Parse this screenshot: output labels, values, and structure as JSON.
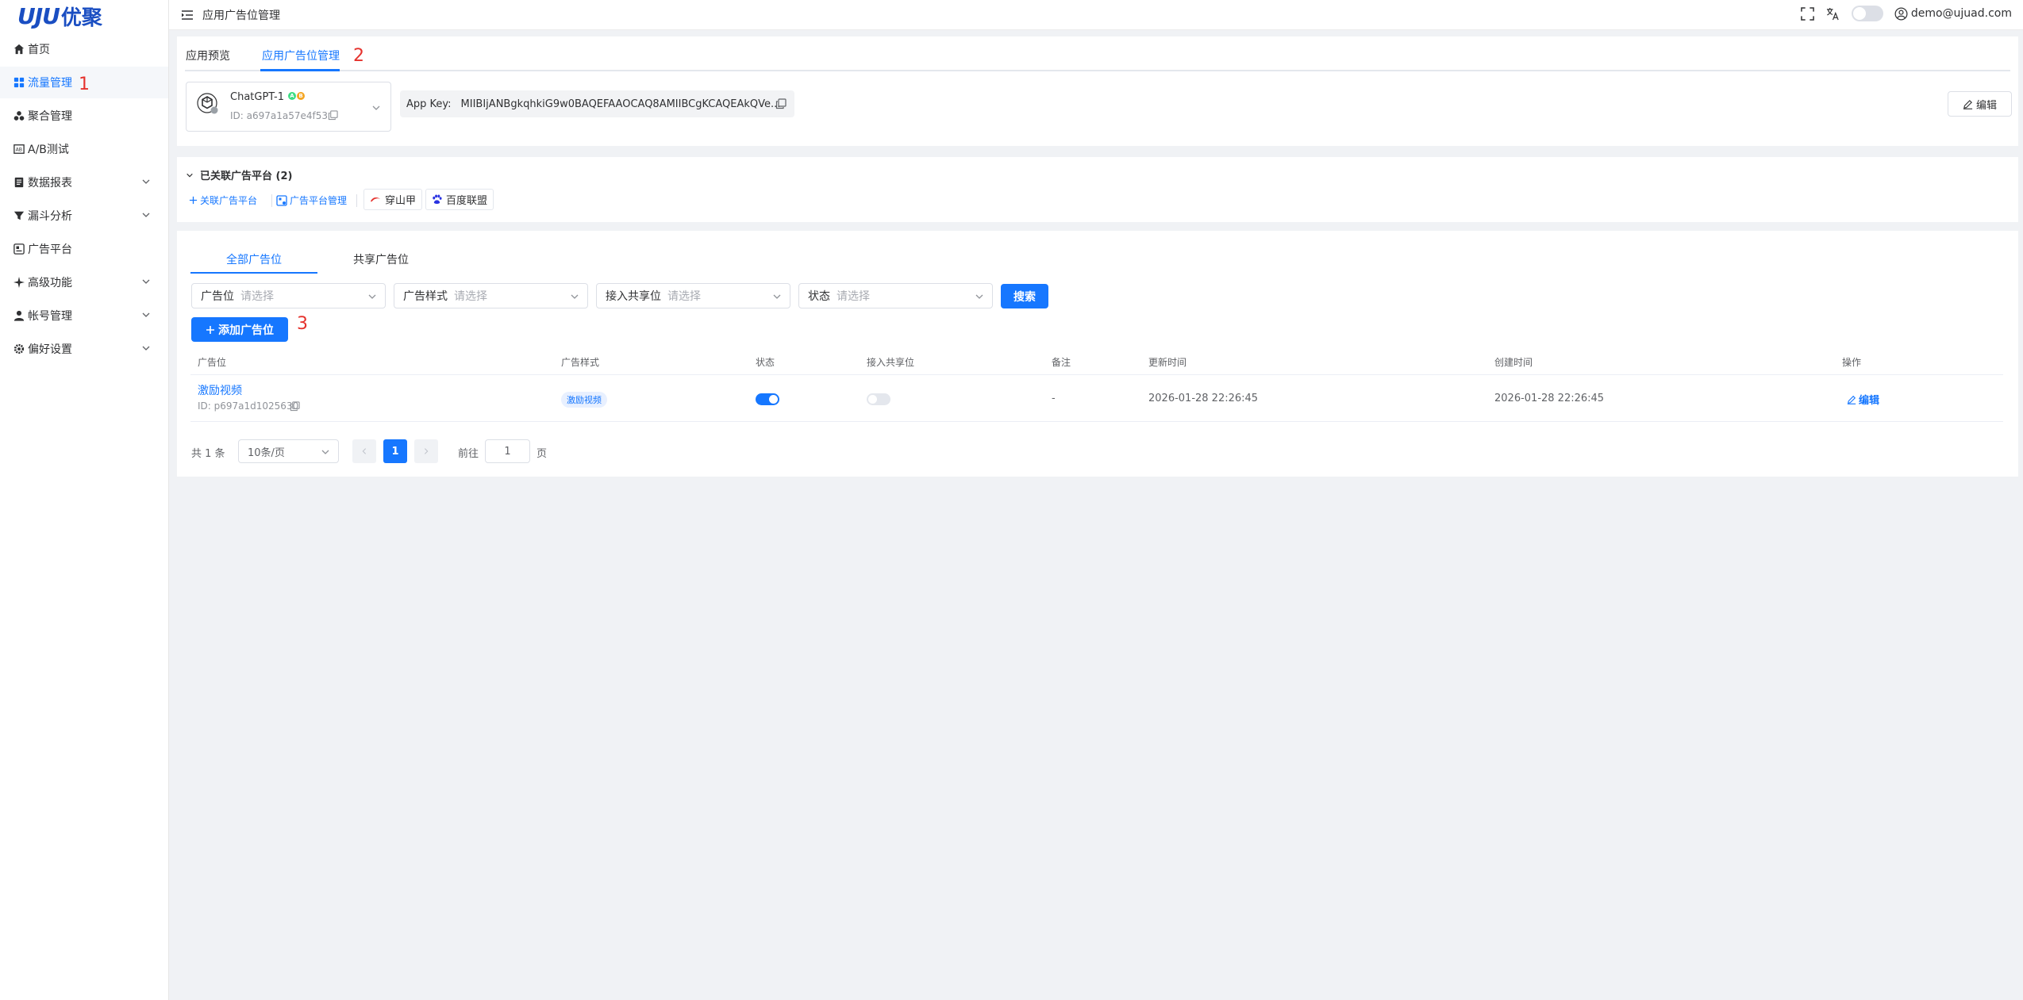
{
  "brand": {
    "logo_mark": "UJU",
    "logo_cn": "优聚"
  },
  "sidebar": {
    "items": [
      {
        "label": "首页",
        "icon": "home-icon"
      },
      {
        "label": "流量管理",
        "icon": "grid-icon",
        "active": true
      },
      {
        "label": "聚合管理",
        "icon": "cluster-icon"
      },
      {
        "label": "A/B测试",
        "icon": "ab-test-icon"
      },
      {
        "label": "数据报表",
        "icon": "report-icon",
        "expandable": true
      },
      {
        "label": "漏斗分析",
        "icon": "funnel-icon",
        "expandable": true
      },
      {
        "label": "广告平台",
        "icon": "ad-platform-icon"
      },
      {
        "label": "高级功能",
        "icon": "sparkle-icon",
        "expandable": true
      },
      {
        "label": "帐号管理",
        "icon": "user-icon",
        "expandable": true
      },
      {
        "label": "偏好设置",
        "icon": "gear-icon",
        "expandable": true
      }
    ]
  },
  "annotations": {
    "a1": "1",
    "a2": "2",
    "a3": "3"
  },
  "header": {
    "title": "应用广告位管理",
    "user_email": "demo@ujuad.com"
  },
  "top_tabs": [
    {
      "label": "应用预览"
    },
    {
      "label": "应用广告位管理",
      "active": true
    }
  ],
  "app": {
    "name": "ChatGPT-1",
    "id_text": "ID: a697a1a57e4f53",
    "app_key_label": "App Key:",
    "app_key_value": "MIIBIjANBgkqhkiG9w0BAQEFAAOCAQ8AMIIBCgKCAQEAkQVe...",
    "edit_label": "编辑"
  },
  "platforms": {
    "section_title": "已关联广告平台 (2)",
    "link_label": "关联广告平台",
    "manage_label": "广告平台管理",
    "tags": [
      "穿山甲",
      "百度联盟"
    ]
  },
  "list": {
    "tabs": [
      {
        "label": "全部广告位",
        "active": true
      },
      {
        "label": "共享广告位"
      }
    ],
    "filters": [
      {
        "label": "广告位",
        "placeholder": "请选择"
      },
      {
        "label": "广告样式",
        "placeholder": "请选择"
      },
      {
        "label": "接入共享位",
        "placeholder": "请选择"
      },
      {
        "label": "状态",
        "placeholder": "请选择"
      }
    ],
    "search_label": "搜索",
    "add_label": "添加广告位",
    "columns": [
      "广告位",
      "广告样式",
      "状态",
      "接入共享位",
      "备注",
      "更新时间",
      "创建时间",
      "操作"
    ],
    "rows": [
      {
        "name": "激励视频",
        "id_text": "ID: p697a1d1025630",
        "style": "激励视频",
        "status": true,
        "shared": false,
        "remark": "-",
        "updated": "2026-01-28 22:26:45",
        "created": "2026-01-28 22:26:45",
        "action": "编辑"
      }
    ]
  },
  "pagination": {
    "total_text": "共 1 条",
    "page_size": "10条/页",
    "current_page": "1",
    "goto_label": "前往",
    "goto_value": "1",
    "page_suffix": "页"
  },
  "colors": {
    "accent": "#1677ff",
    "annotation": "#e5322d"
  }
}
